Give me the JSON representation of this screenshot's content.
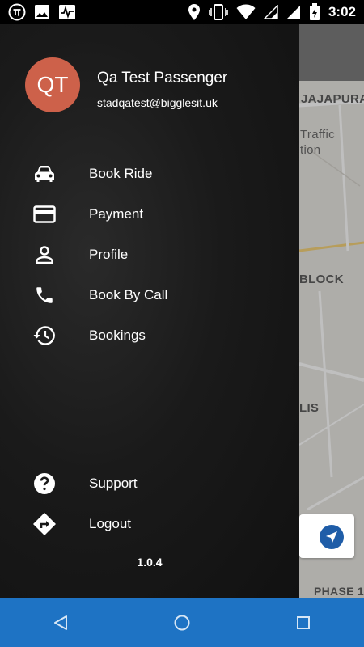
{
  "status_bar": {
    "time": "3:02",
    "left_icons": [
      "pi-icon",
      "image-icon",
      "pulse-icon"
    ],
    "right_icons": [
      "location-icon",
      "vibrate-icon",
      "wifi-icon",
      "signal-icon",
      "signal-icon",
      "battery-charging-icon"
    ]
  },
  "map": {
    "labels": {
      "jajapura": "JAJAPURA",
      "traffic": "Traffic",
      "station": "tion",
      "block": "BLOCK",
      "lis": "LIS",
      "phase": "PHASE 1"
    }
  },
  "drawer": {
    "avatar_initials": "QT",
    "user_name": "Qa Test Passenger",
    "user_email": "stadqatest@bigglesit.uk",
    "menu": [
      {
        "label": "Book Ride",
        "icon": "car-icon"
      },
      {
        "label": "Payment",
        "icon": "credit-card-icon"
      },
      {
        "label": "Profile",
        "icon": "person-icon"
      },
      {
        "label": "Book By Call",
        "icon": "phone-icon"
      },
      {
        "label": "Bookings",
        "icon": "history-icon"
      }
    ],
    "bottom_menu": [
      {
        "label": "Support",
        "icon": "help-icon"
      },
      {
        "label": "Logout",
        "icon": "directions-icon"
      }
    ],
    "version": "1.0.4"
  },
  "nav_bar": {
    "buttons": [
      "back-icon",
      "home-icon",
      "recents-icon"
    ]
  },
  "colors": {
    "avatar": "#cd614a",
    "nav_bar": "#1e73c4",
    "drawer": "#1a1a1a",
    "locate_button": "#1f5da8"
  }
}
